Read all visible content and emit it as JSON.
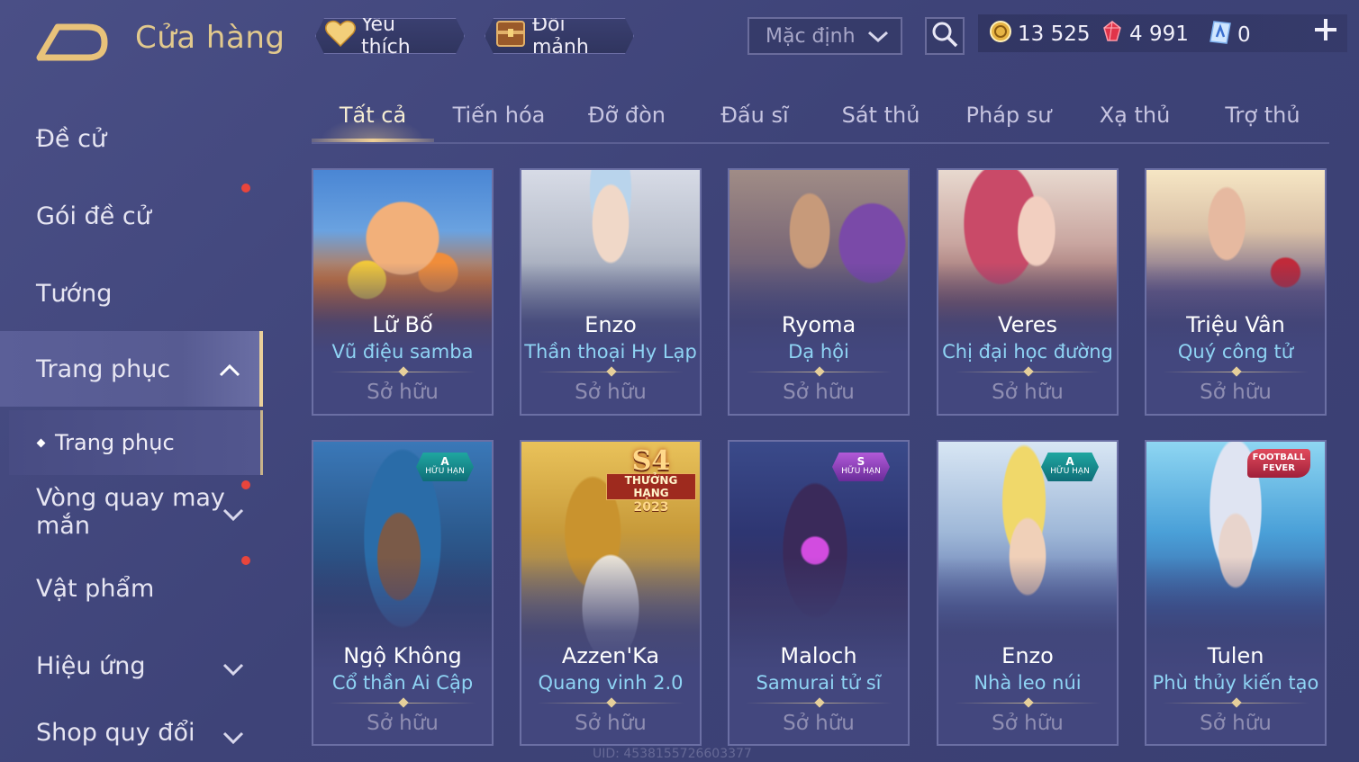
{
  "header": {
    "title": "Cửa hàng",
    "favorites_label": "Yêu thích",
    "shards_label": "Đổi mảnh",
    "sort_value": "Mặc định",
    "currency": {
      "gold": "13 525",
      "ruby": "4 991",
      "voucher": "0"
    }
  },
  "sidebar": {
    "items": [
      {
        "label": "Đề cử"
      },
      {
        "label": "Gói đề cử"
      },
      {
        "label": "Tướng"
      },
      {
        "label": "Trang phục"
      },
      {
        "label": "Vòng quay may",
        "label2": "mắn"
      },
      {
        "label": "Vật phẩm"
      },
      {
        "label": "Hiệu ứng"
      },
      {
        "label": "Shop quy đổi"
      }
    ],
    "subitem": "Trang phục"
  },
  "tabs": [
    "Tất cả",
    "Tiến hóa",
    "Đỡ đòn",
    "Đấu sĩ",
    "Sát thủ",
    "Pháp sư",
    "Xạ thủ",
    "Trợ thủ"
  ],
  "cards": [
    {
      "hero": "Lữ Bố",
      "skin": "Vũ điệu samba",
      "status": "Sở hữu"
    },
    {
      "hero": "Enzo",
      "skin": "Thần thoại Hy Lạp",
      "status": "Sở hữu"
    },
    {
      "hero": "Ryoma",
      "skin": "Dạ hội",
      "status": "Sở hữu"
    },
    {
      "hero": "Veres",
      "skin": "Chị đại học đường",
      "status": "Sở hữu"
    },
    {
      "hero": "Triệu Vân",
      "skin": "Quý công tử",
      "status": "Sở hữu"
    },
    {
      "hero": "Ngộ Không",
      "skin": "Cổ thần Ai Cập",
      "status": "Sở hữu",
      "badge_tier": "A",
      "badge_text": "HỮU HẠN"
    },
    {
      "hero": "Azzen'Ka",
      "skin": "Quang vinh 2.0",
      "status": "Sở hữu",
      "event_big": "S4",
      "event_mid": "THƯỞNG HẠNG",
      "event_year": "2023"
    },
    {
      "hero": "Maloch",
      "skin": "Samurai tử sĩ",
      "status": "Sở hữu",
      "badge_tier": "S",
      "badge_text": "HỮU HẠN"
    },
    {
      "hero": "Enzo",
      "skin": "Nhà leo núi",
      "status": "Sở hữu",
      "badge_tier": "A",
      "badge_text": "HỮU HẠN"
    },
    {
      "hero": "Tulen",
      "skin": "Phù thủy kiến tạo",
      "status": "Sở hữu",
      "event_text": "FOOTBALL FEVER"
    }
  ],
  "uid": "UID: 4538155726603377",
  "colors": {
    "title_gold": "#e2c98d",
    "skin_blue": "#8fd4f4",
    "notify_red": "#e8453c"
  }
}
